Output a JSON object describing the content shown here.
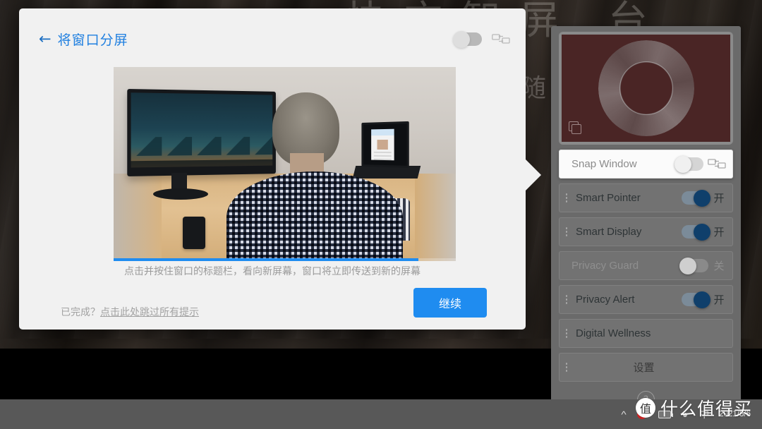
{
  "background": {
    "top_text": "快充智屏  台",
    "side_text": "随"
  },
  "dialog": {
    "back_arrow": "←",
    "title": "将窗口分屏",
    "caption": "点击并按住窗口的标题栏，看向新屏幕，窗口将立即传送到新的屏幕",
    "skip_prefix": "已完成？",
    "skip_link": "点击此处跳过所有提示",
    "continue_label": "继续",
    "header_toggle_state": "off",
    "header_monitor_icon": "transfer-monitor-icon",
    "progress_percent": 89,
    "accent_color": "#1f8cf0",
    "title_color": "#1f7fe0"
  },
  "sidebar": {
    "preview": {
      "icon": "copy-window-icon",
      "screen_color": "#4a2525"
    },
    "items": [
      {
        "label": "Snap Window",
        "toggle": "off",
        "state_label": "",
        "active": true,
        "has_grip": false,
        "has_monitor_icon": true
      },
      {
        "label": "Smart Pointer",
        "toggle": "on",
        "state_label": "开",
        "active": false,
        "has_grip": true,
        "has_monitor_icon": false
      },
      {
        "label": "Smart Display",
        "toggle": "on",
        "state_label": "开",
        "active": false,
        "has_grip": true,
        "has_monitor_icon": false
      },
      {
        "label": "Privacy Guard",
        "toggle": "off",
        "state_label": "关",
        "active": false,
        "has_grip": false,
        "has_monitor_icon": false,
        "dim": true
      },
      {
        "label": "Privacy Alert",
        "toggle": "on",
        "state_label": "开",
        "active": false,
        "has_grip": true,
        "has_monitor_icon": false
      },
      {
        "label": "Digital Wellness",
        "toggle": "none",
        "state_label": "",
        "active": false,
        "has_grip": true,
        "has_monitor_icon": false
      },
      {
        "label": "设置",
        "toggle": "none",
        "state_label": "",
        "active": false,
        "has_grip": true,
        "has_monitor_icon": false,
        "center": true
      }
    ],
    "help_label": "?"
  },
  "taskbar": {
    "chevron": "^",
    "icons": [
      "record-dot-icon",
      "battery-icon",
      "wifi-icon",
      "ime-icon"
    ],
    "date": "2021/5/6",
    "time": ""
  },
  "watermark": {
    "badge": "值",
    "text": "什么值得买"
  }
}
